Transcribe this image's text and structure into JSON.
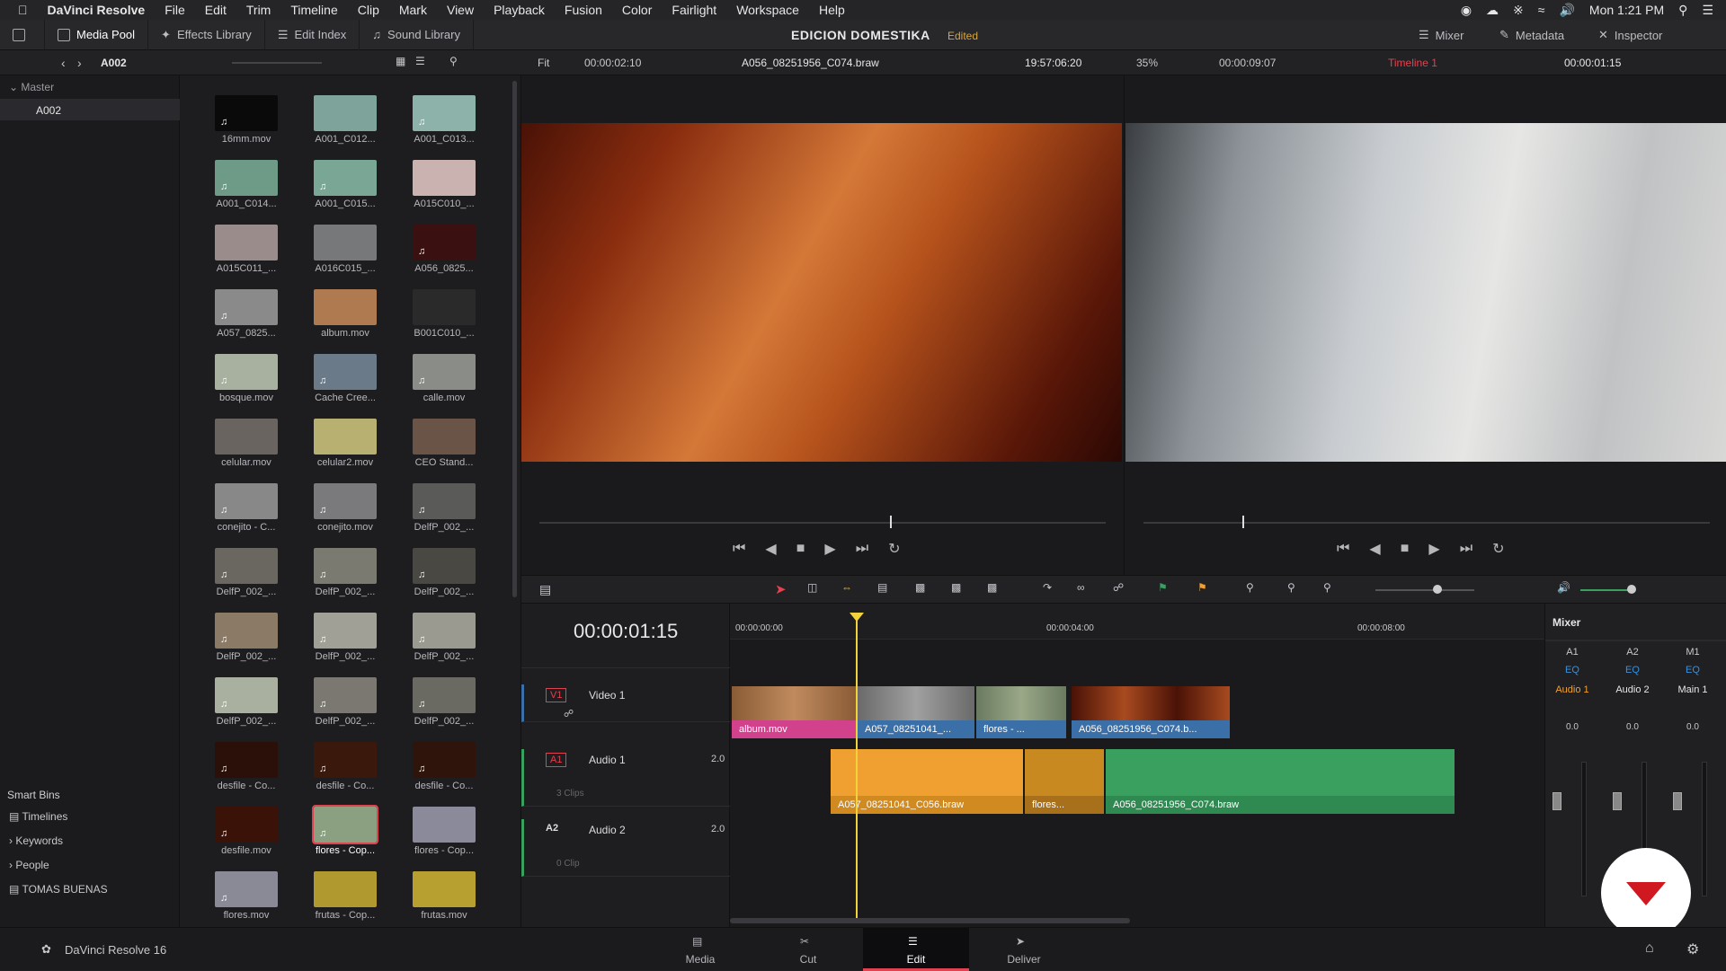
{
  "menubar": {
    "app": "DaVinci Resolve",
    "items": [
      "File",
      "Edit",
      "Trim",
      "Timeline",
      "Clip",
      "Mark",
      "View",
      "Playback",
      "Fusion",
      "Color",
      "Fairlight",
      "Workspace",
      "Help"
    ],
    "clock": "Mon 1:21 PM"
  },
  "toolbar": {
    "media_pool": "Media Pool",
    "effects_library": "Effects Library",
    "edit_index": "Edit Index",
    "sound_library": "Sound Library",
    "project_title": "EDICION DOMESTIKA",
    "status": "Edited",
    "mixer": "Mixer",
    "metadata": "Metadata",
    "inspector": "Inspector"
  },
  "subbar": {
    "bin": "A002",
    "src_fit": "Fit",
    "src_duration": "00:00:02:10",
    "src_clip": "A056_08251956_C074.braw",
    "src_tc": "19:57:06:20",
    "rec_zoom": "35%",
    "rec_duration": "00:00:09:07",
    "timeline_name": "Timeline 1",
    "rec_tc": "00:00:01:15"
  },
  "left_panel": {
    "master": "Master",
    "selected_bin": "A002",
    "smart_bins": "Smart Bins",
    "smart_items": [
      "Timelines",
      "Keywords",
      "People",
      "TOMAS BUENAS"
    ]
  },
  "clips": [
    {
      "label": "16mm.mov",
      "color": "#0a0a0a",
      "audio": true
    },
    {
      "label": "A001_C012...",
      "color": "#7ea39a",
      "audio": false
    },
    {
      "label": "A001_C013...",
      "color": "#8db2aa",
      "audio": true
    },
    {
      "label": "A001_C014...",
      "color": "#6e9a88",
      "audio": true
    },
    {
      "label": "A001_C015...",
      "color": "#7aa696",
      "audio": true
    },
    {
      "label": "A015C010_...",
      "color": "#c9b2b0",
      "audio": false
    },
    {
      "label": "A015C011_...",
      "color": "#9a8c8a",
      "audio": false
    },
    {
      "label": "A016C015_...",
      "color": "#77787a",
      "audio": false
    },
    {
      "label": "A056_0825...",
      "color": "#3a1010",
      "audio": true
    },
    {
      "label": "A057_0825...",
      "color": "#8a8a8a",
      "audio": true
    },
    {
      "label": "album.mov",
      "color": "#b07a50",
      "audio": false
    },
    {
      "label": "B001C010_...",
      "color": "#2a2a2a",
      "audio": false
    },
    {
      "label": "bosque.mov",
      "color": "#a8b0a0",
      "audio": true
    },
    {
      "label": "Cache Cree...",
      "color": "#6a7a88",
      "audio": true
    },
    {
      "label": "calle.mov",
      "color": "#8a8c88",
      "audio": true
    },
    {
      "label": "celular.mov",
      "color": "#6a6460",
      "audio": false
    },
    {
      "label": "celular2.mov",
      "color": "#b8b070",
      "audio": false
    },
    {
      "label": "CEO Stand...",
      "color": "#6a5448",
      "audio": false
    },
    {
      "label": "conejito - C...",
      "color": "#888",
      "audio": true
    },
    {
      "label": "conejito.mov",
      "color": "#7a7a7c",
      "audio": true
    },
    {
      "label": "DelfP_002_...",
      "color": "#5a5a58",
      "audio": true
    },
    {
      "label": "DelfP_002_...",
      "color": "#6a6660",
      "audio": true
    },
    {
      "label": "DelfP_002_...",
      "color": "#7a7a70",
      "audio": true
    },
    {
      "label": "DelfP_002_...",
      "color": "#4a4842",
      "audio": true
    },
    {
      "label": "DelfP_002_...",
      "color": "#8a7a66",
      "audio": true
    },
    {
      "label": "DelfP_002_...",
      "color": "#a0a096",
      "audio": true
    },
    {
      "label": "DelfP_002_...",
      "color": "#9a9a90",
      "audio": true
    },
    {
      "label": "DelfP_002_...",
      "color": "#aab0a0",
      "audio": true
    },
    {
      "label": "DelfP_002_...",
      "color": "#7a7870",
      "audio": true
    },
    {
      "label": "DelfP_002_...",
      "color": "#6a6a62",
      "audio": true
    },
    {
      "label": "desfile - Co...",
      "color": "#2a1008",
      "audio": true
    },
    {
      "label": "desfile - Co...",
      "color": "#3a180c",
      "audio": true
    },
    {
      "label": "desfile - Co...",
      "color": "#2e140a",
      "audio": true
    },
    {
      "label": "desfile.mov",
      "color": "#3a1208",
      "audio": true
    },
    {
      "label": "flores - Cop...",
      "color": "#8aa080",
      "audio": true
    },
    {
      "label": "flores - Cop...",
      "color": "#8a8a9a",
      "audio": false
    },
    {
      "label": "flores.mov",
      "color": "#8a8a96",
      "audio": true
    },
    {
      "label": "frutas - Cop...",
      "color": "#b09a30",
      "audio": false
    },
    {
      "label": "frutas.mov",
      "color": "#b8a030",
      "audio": false
    }
  ],
  "timeline": {
    "timecode": "00:00:01:15",
    "ruler": [
      "00:00:00:00",
      "00:00:04:00",
      "00:00:08:00"
    ],
    "tracks": [
      {
        "id": "V1",
        "name": "Video 1",
        "info": ""
      },
      {
        "id": "A1",
        "name": "Audio 1",
        "level": "2.0",
        "info": "3 Clips"
      },
      {
        "id": "A2",
        "name": "Audio 2",
        "level": "2.0",
        "info": "0 Clip"
      }
    ],
    "video_clips": [
      "album.mov",
      "A057_08251041_...",
      "flores - ...",
      "A056_08251956_C074.b..."
    ],
    "audio_clips": [
      "A057_08251041_C056.braw",
      "flores...",
      "A056_08251956_C074.braw"
    ]
  },
  "mixer": {
    "title": "Mixer",
    "channels": [
      {
        "id": "A1",
        "name": "Audio 1",
        "eq": "EQ",
        "level": "0.0"
      },
      {
        "id": "A2",
        "name": "Audio 2",
        "eq": "EQ",
        "level": "0.0"
      },
      {
        "id": "M1",
        "name": "Main 1",
        "eq": "EQ",
        "level": "0.0"
      }
    ],
    "scale": [
      "0",
      "-5",
      "-10",
      "-15",
      "-20",
      "-25",
      "-30",
      "-35",
      "-40",
      "-45",
      "-50"
    ]
  },
  "bottom": {
    "version": "DaVinci Resolve 16",
    "pages": [
      "Media",
      "Cut",
      "Edit",
      "Deliver"
    ],
    "active_page": "Edit"
  },
  "colors": {
    "accent": "#e0424f",
    "video_clip": "#3a6fa8",
    "audio_orange": "#f0a030",
    "audio_green": "#3aa060",
    "playhead": "#f2d23c"
  }
}
